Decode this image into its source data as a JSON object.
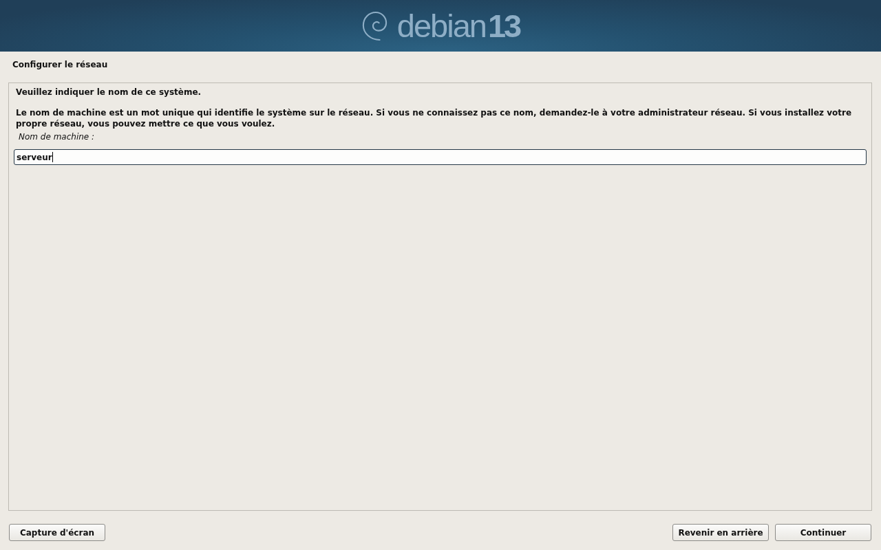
{
  "banner": {
    "logo_text": "debian",
    "version": "13"
  },
  "step_title": "Configurer le réseau",
  "dialog": {
    "question": "Veuillez indiquer le nom de ce système.",
    "description": "Le nom de machine est un mot unique qui identifie le système sur le réseau. Si vous ne connaissez pas ce nom, demandez-le à votre administrateur réseau. Si vous installez votre propre réseau, vous pouvez mettre ce que vous voulez.",
    "field": {
      "label": "Nom de machine :",
      "value": "serveur",
      "focused": true
    }
  },
  "screenshot_button": {
    "label": "Capture d'écran"
  },
  "navigation_buttons": [
    {
      "label": "Revenir en arrière"
    },
    {
      "label": "Continuer"
    }
  ]
}
